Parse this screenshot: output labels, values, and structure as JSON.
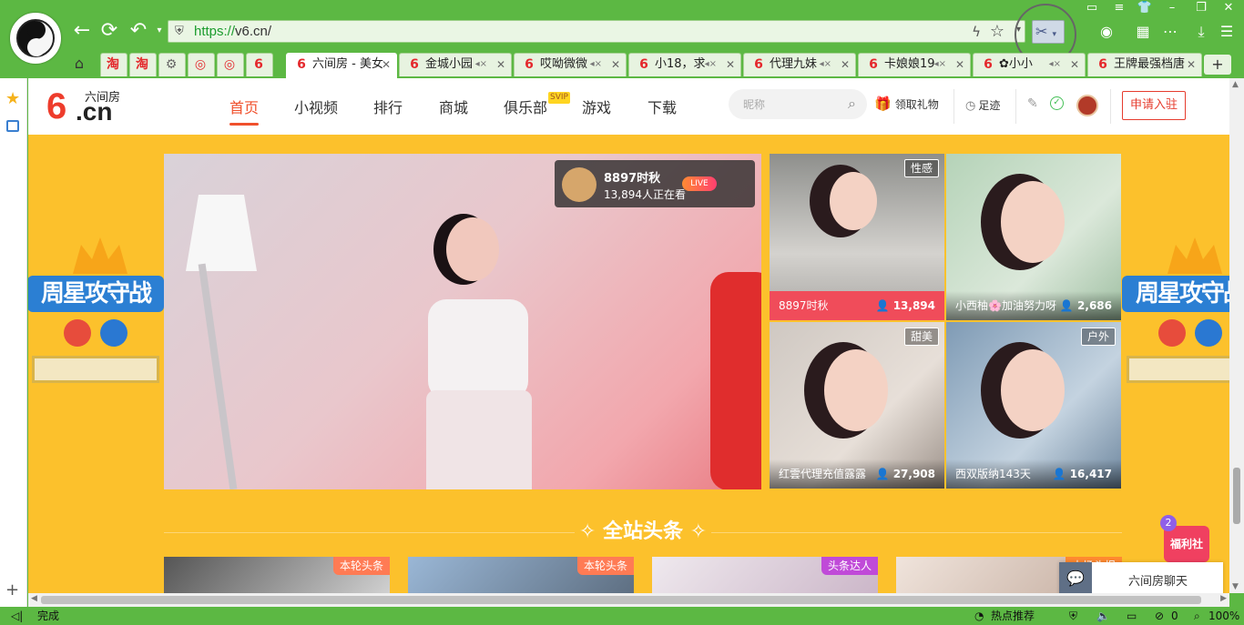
{
  "browser": {
    "url_scheme": "https://",
    "url_rest": "v6.cn/",
    "tabs": [
      {
        "label": "淘",
        "icon": "taobao-icon"
      },
      {
        "label": "淘",
        "icon": "taobao-icon"
      },
      {
        "label": "",
        "icon": "gear-icon"
      },
      {
        "label": "",
        "icon": "weibo-icon"
      },
      {
        "label": "",
        "icon": "weibo-icon"
      },
      {
        "label": "6",
        "icon": "six-icon"
      },
      {
        "label": "六间房 - 美女",
        "icon": "six-icon"
      },
      {
        "label": "金城小园",
        "icon": "six-icon"
      },
      {
        "label": "哎呦微微",
        "icon": "six-icon"
      },
      {
        "label": "小18，求",
        "icon": "six-icon"
      },
      {
        "label": "代理九妹",
        "icon": "six-icon"
      },
      {
        "label": "卡娘娘19",
        "icon": "six-icon"
      },
      {
        "label": "✿小小",
        "icon": "six-icon"
      },
      {
        "label": "王牌最强档唐",
        "icon": "six-icon"
      }
    ],
    "new_tab": "+"
  },
  "site": {
    "logo_six": "6",
    "logo_cn": ".cn",
    "logo_name": "六间房",
    "nav": [
      "首页",
      "小视频",
      "排行",
      "商城",
      "俱乐部",
      "游戏",
      "下载"
    ],
    "svip": "SVIP",
    "search_placeholder": "昵称",
    "gift": "领取礼物",
    "footprint": "足迹",
    "apply": "申请入驻"
  },
  "banner": {
    "side_title": "周星攻守战"
  },
  "live": {
    "name": "8897时秋",
    "count": "13,894人正在看",
    "badge": "LIVE"
  },
  "cards": [
    {
      "tag": "性感",
      "name": "8897时秋",
      "count": "13,894"
    },
    {
      "tag": "",
      "name": "小西柚🌸加油努力呀",
      "count": "2,686"
    },
    {
      "tag": "甜美",
      "name": "红雲代理充值露露",
      "count": "27,908"
    },
    {
      "tag": "户外",
      "name": "西双版纳143天",
      "count": "16,417"
    }
  ],
  "headline": {
    "title": "全站头条",
    "tags": [
      "本轮头条",
      "本轮头条",
      "头条达人",
      "大扬头报"
    ]
  },
  "chat": {
    "label": "六间房聊天"
  },
  "welfare": {
    "label": "福利社",
    "count": "2"
  },
  "status": {
    "done": "完成",
    "hot": "热点推荐",
    "zero": "0",
    "zoom": "100%"
  },
  "colors": {
    "browser_green": "#5cb843",
    "page_yellow": "#fcc12c",
    "accent_red": "#f0502c"
  }
}
